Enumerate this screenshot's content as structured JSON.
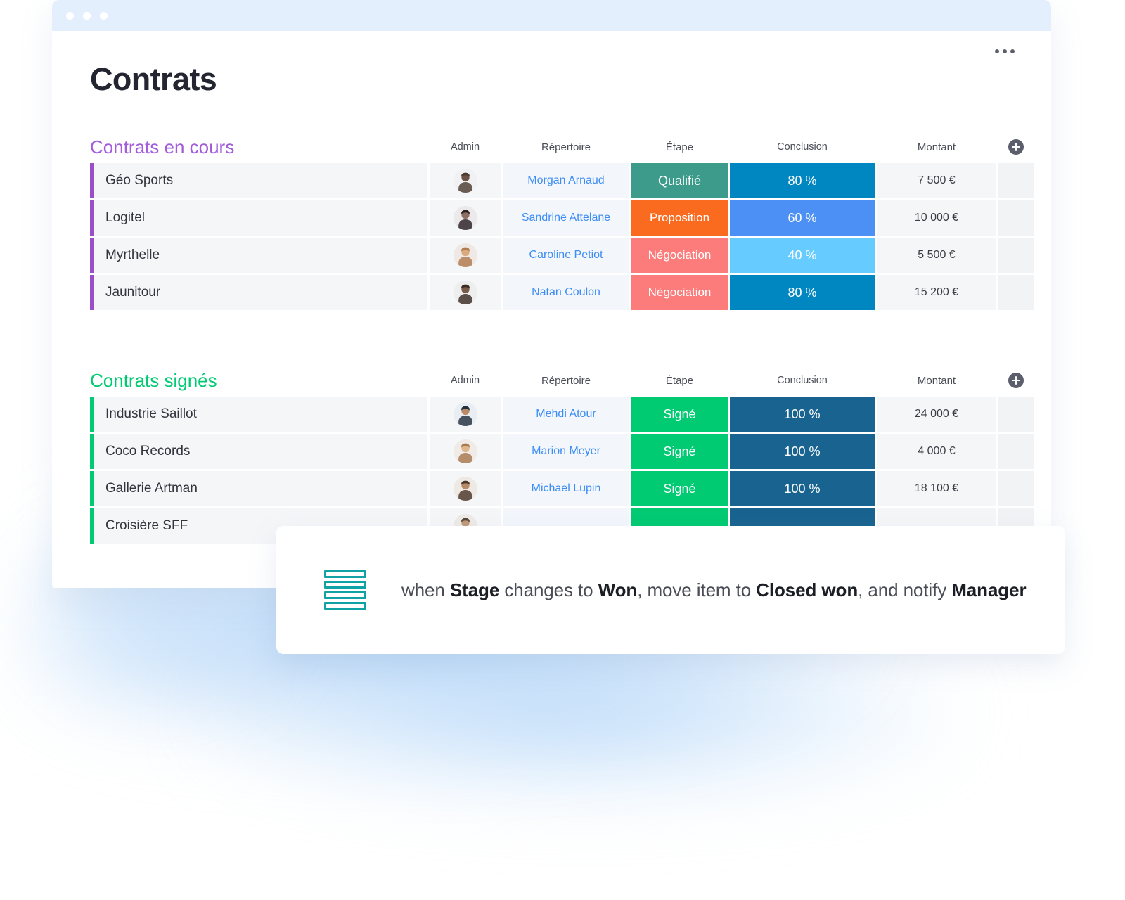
{
  "window": {
    "traffic_lights": [
      "close-dot",
      "minimize-dot",
      "maximize-dot"
    ],
    "accent_titlebar": "#e3effc"
  },
  "header": {
    "title": "Contrats",
    "more_menu": "..."
  },
  "columns": {
    "admin": "Admin",
    "repertoire": "Répertoire",
    "etape": "Étape",
    "conclusion": "Conclusion",
    "montant": "Montant",
    "add": "+"
  },
  "groups": [
    {
      "title": "Contrats en cours",
      "color": "#a25ddc",
      "bar_color": "#9b4dca",
      "rows": [
        {
          "name": "Géo Sports",
          "person": "Morgan Arnaud",
          "etape": "Qualifié",
          "etape_color": "#3d9b8c",
          "conclusion": "80 %",
          "conclusion_color": "#0086c0",
          "montant": "7 500 €"
        },
        {
          "name": "Logitel",
          "person": "Sandrine Attelane",
          "etape": "Proposition",
          "etape_color": "#fb6b1f",
          "conclusion": "60 %",
          "conclusion_color": "#4d90f5",
          "montant": "10 000 €"
        },
        {
          "name": "Myrthelle",
          "person": "Caroline Petiot",
          "etape": "Négociation",
          "etape_color": "#fc7b7b",
          "conclusion": "40 %",
          "conclusion_color": "#66ccff",
          "montant": "5 500 €"
        },
        {
          "name": "Jaunitour",
          "person": "Natan Coulon",
          "etape": "Négociation",
          "etape_color": "#fc7b7b",
          "conclusion": "80 %",
          "conclusion_color": "#0086c0",
          "montant": "15 200 €"
        }
      ]
    },
    {
      "title": "Contrats signés",
      "color": "#00ca72",
      "bar_color": "#00ca72",
      "rows": [
        {
          "name": "Industrie Saillot",
          "person": "Mehdi Atour",
          "etape": "Signé",
          "etape_color": "#00ca72",
          "conclusion": "100 %",
          "conclusion_color": "#18638f",
          "montant": "24 000 €"
        },
        {
          "name": "Coco Records",
          "person": "Marion Meyer",
          "etape": "Signé",
          "etape_color": "#00ca72",
          "conclusion": "100 %",
          "conclusion_color": "#18638f",
          "montant": "4 000 €"
        },
        {
          "name": "Gallerie Artman",
          "person": "Michael Lupin",
          "etape": "Signé",
          "etape_color": "#00ca72",
          "conclusion": "100 %",
          "conclusion_color": "#18638f",
          "montant": "18 100 €"
        },
        {
          "name": "Croisière SFF",
          "person": "",
          "etape": "",
          "etape_color": "#00ca72",
          "conclusion": "",
          "conclusion_color": "#18638f",
          "montant": ""
        }
      ]
    }
  ],
  "automation": {
    "icon": "stacked-bars-icon",
    "icon_color": "#11a2a6",
    "parts": [
      {
        "text": "when ",
        "bold": false
      },
      {
        "text": "Stage",
        "bold": true
      },
      {
        "text": " changes to ",
        "bold": false
      },
      {
        "text": "Won",
        "bold": true
      },
      {
        "text": ", move item to ",
        "bold": false
      },
      {
        "text": "Closed won",
        "bold": true
      },
      {
        "text": ", and notify ",
        "bold": false
      },
      {
        "text": "Manager",
        "bold": true
      }
    ]
  }
}
